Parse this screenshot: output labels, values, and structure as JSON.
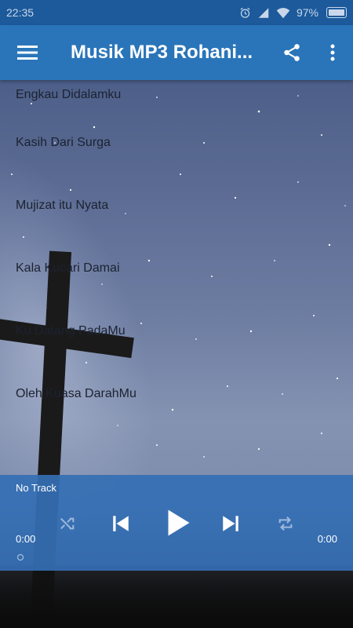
{
  "status_bar": {
    "time": "22:35",
    "battery": "97%"
  },
  "app_bar": {
    "title": "Musik MP3 Rohani..."
  },
  "tracks": [
    "Engkau Didalamku",
    "Kasih Dari Surga",
    "Mujizat itu Nyata",
    "Kala Kucari Damai",
    "Ku Datang PadaMu",
    "Oleh Kuasa DarahMu"
  ],
  "player": {
    "now_playing": "No Track",
    "elapsed": "0:00",
    "duration": "0:00"
  },
  "colors": {
    "status_bar": "#1c5a9c",
    "app_bar": "#2a75b9",
    "player": "#346fb4"
  },
  "icons": [
    "menu-icon",
    "share-icon",
    "more-vert-icon",
    "shuffle-icon",
    "skip-previous-icon",
    "play-icon",
    "skip-next-icon",
    "repeat-icon",
    "alarm-icon",
    "signal-icon",
    "wifi-icon",
    "battery-icon"
  ]
}
